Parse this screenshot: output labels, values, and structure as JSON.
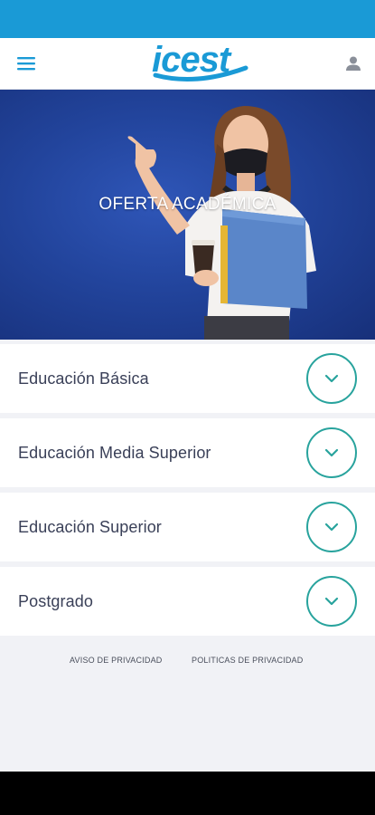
{
  "header": {
    "logo_text": "icest",
    "menu_icon": "hamburger-menu-icon",
    "user_icon": "user-icon"
  },
  "hero": {
    "title": "OFERTA ACADÉMICA"
  },
  "sections": [
    {
      "label": "Educación Básica",
      "icon": "chevron-down-icon"
    },
    {
      "label": "Educación Media Superior",
      "icon": "chevron-down-icon"
    },
    {
      "label": "Educación Superior",
      "icon": "chevron-down-icon"
    },
    {
      "label": "Postgrado",
      "icon": "chevron-down-icon"
    }
  ],
  "footer": {
    "privacy_notice": "AVISO DE PRIVACIDAD",
    "privacy_policies": "POLITICAS DE PRIVACIDAD"
  },
  "colors": {
    "status_bar": "#1a9ad6",
    "brand_blue": "#1a9ad6",
    "hero_bg": "#22449c",
    "accent_teal": "#28a39d",
    "label_text": "#3a4058",
    "page_bg": "#f1f2f6"
  }
}
